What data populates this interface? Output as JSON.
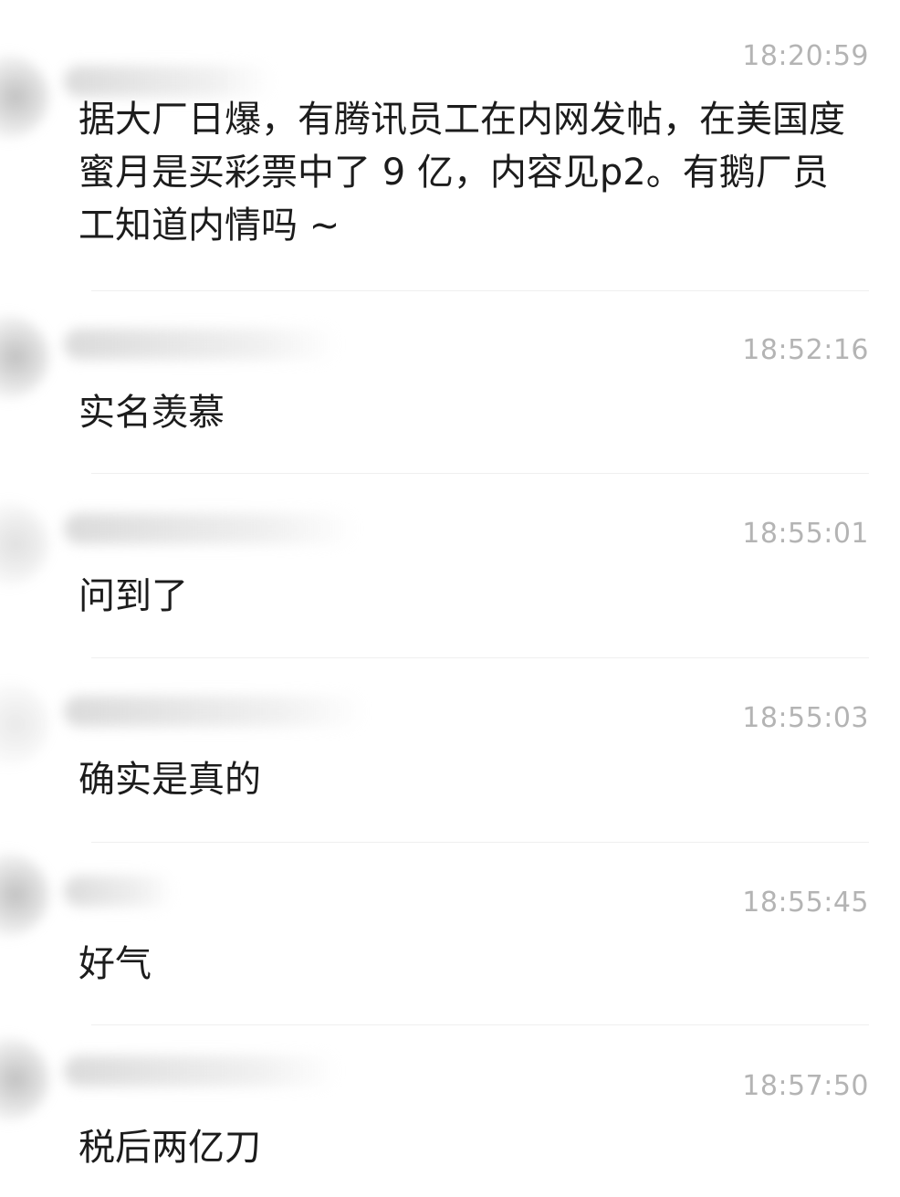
{
  "messages": [
    {
      "time": "18:20:59",
      "text": "据大厂日爆，有腾讯员工在内网发帖，在美国度蜜月是买彩票中了 9 亿，内容见p2。有鹅厂员工知道内情吗 ~"
    },
    {
      "time": "18:52:16",
      "text": "实名羡慕"
    },
    {
      "time": "18:55:01",
      "text": "问到了"
    },
    {
      "time": "18:55:03",
      "text": "确实是真的"
    },
    {
      "time": "18:55:45",
      "text": "好气"
    },
    {
      "time": "18:57:50",
      "text": "税后两亿刀"
    }
  ]
}
